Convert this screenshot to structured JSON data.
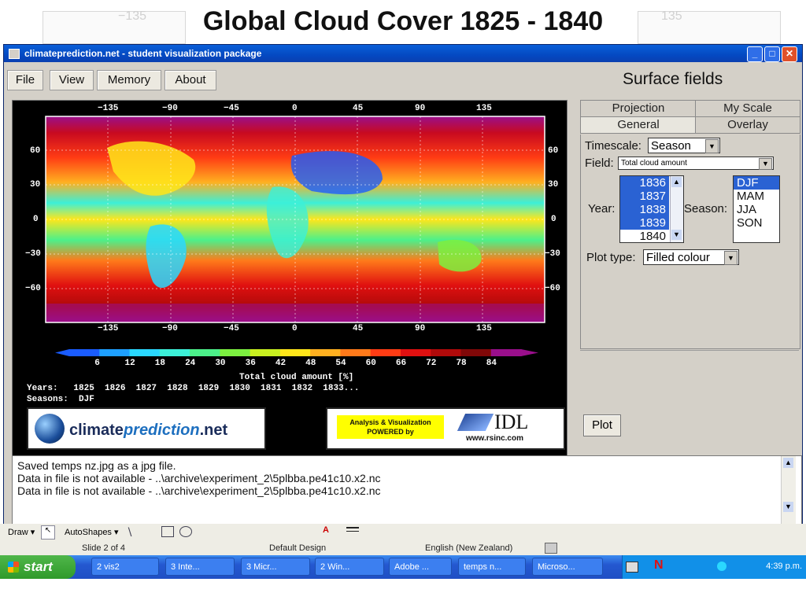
{
  "slide": {
    "title": "Global Cloud Cover 1825 - 1840",
    "ghost_labels": [
      "−135",
      "135"
    ]
  },
  "window": {
    "title": "climateprediction.net - student visualization package",
    "controls": [
      "_",
      "□",
      "✕"
    ]
  },
  "menu": [
    {
      "label": "File"
    },
    {
      "label": "View"
    },
    {
      "label": "Memory"
    },
    {
      "label": "About"
    }
  ],
  "right_panel": {
    "header": "Surface fields",
    "tabs_top": [
      "Projection",
      "My Scale"
    ],
    "tabs_bottom": [
      "General",
      "Overlay"
    ],
    "timescale_label": "Timescale:",
    "timescale_value": "Season",
    "field_label": "Field:",
    "field_value": "Total cloud amount",
    "year_label": "Year:",
    "years": [
      "1836",
      "1837",
      "1838",
      "1839",
      "1840"
    ],
    "years_selected": [
      true,
      true,
      true,
      true,
      false
    ],
    "season_label": "Season:",
    "seasons": [
      "DJF",
      "MAM",
      "JJA",
      "SON"
    ],
    "seasons_selected": [
      true,
      false,
      false,
      false
    ],
    "plot_type_label": "Plot type:",
    "plot_type_value": "Filled colour",
    "plot_button": "Plot"
  },
  "map": {
    "top_ticks": [
      "−135",
      "−90",
      "−45",
      "0",
      "45",
      "90",
      "135"
    ],
    "bottom_ticks": [
      "−135",
      "−90",
      "−45",
      "0",
      "45",
      "90",
      "135"
    ],
    "left_ticks": [
      "60",
      "30",
      "0",
      "−30",
      "−60"
    ],
    "right_ticks": [
      "60",
      "30",
      "0",
      "−30",
      "−60"
    ],
    "colorbar_labels": [
      "6",
      "12",
      "18",
      "24",
      "30",
      "36",
      "42",
      "48",
      "54",
      "60",
      "66",
      "72",
      "78",
      "84"
    ],
    "colorbar_colors": [
      "#1a5cff",
      "#1ea0ff",
      "#2ad8ff",
      "#3cf0d8",
      "#4cf08a",
      "#7cf040",
      "#c8f020",
      "#ffe61a",
      "#ffb020",
      "#ff7a1a",
      "#ff3c14",
      "#e01010",
      "#b00a0a",
      "#800808",
      "#9a0f8c"
    ],
    "colorbar_title": "Total cloud amount [%]",
    "years_line": "Years:   1825  1826  1827  1828  1829  1830  1831  1832  1833...",
    "seasons_line": "Seasons:  DJF"
  },
  "logos": {
    "cpn_text_a": "climate",
    "cpn_text_b": "prediction",
    "cpn_text_c": ".net",
    "idl_caption_1": "Analysis & Visualization",
    "idl_caption_2": "POWERED by",
    "idl_name": "IDL",
    "idl_url": "www.rsinc.com"
  },
  "log": {
    "lines": [
      "Saved temps nz.jpg as a jpg file.",
      "Data in file is not available - ..\\archive\\experiment_2\\5plbba.pe41c10.x2.nc",
      "Data in file is not available - ..\\archive\\experiment_2\\5plbba.pe41c10.x2.nc"
    ]
  },
  "ppt": {
    "draw_label": "Draw ▾",
    "autoshapes_label": "AutoShapes ▾",
    "slide_status": "Slide 2 of 4",
    "design_status": "Default Design",
    "language_status": "English (New Zealand)"
  },
  "taskbar": {
    "start": "start",
    "tasks": [
      "2 vis2",
      "3 Inte...",
      "3 Micr...",
      "2 Win...",
      "Adobe ...",
      "temps n...",
      "Microso..."
    ],
    "clock": "4:39 p.m."
  },
  "colors": {
    "window_blue": "#0449c2",
    "selection_blue": "#2a62d3",
    "taskbar_blue": "#2458d0",
    "start_green": "#2f9a2a"
  }
}
